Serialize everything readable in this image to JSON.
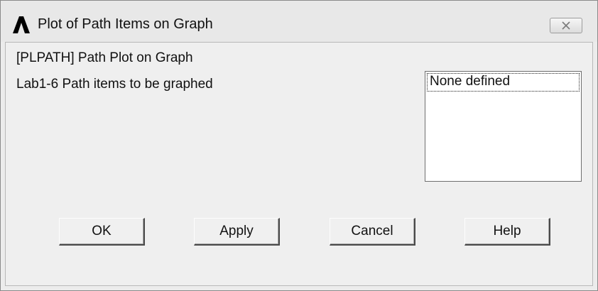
{
  "window": {
    "title": "Plot of Path Items on Graph",
    "icon": "ansys-a-logo-icon",
    "close_icon": "close-icon"
  },
  "content": {
    "command_label": "[PLPATH]  Path Plot on Graph",
    "field_label": "Lab1-6  Path items to be graphed",
    "listbox": {
      "items": [
        "None defined"
      ],
      "selected": "None defined"
    }
  },
  "buttons": {
    "ok": "OK",
    "apply": "Apply",
    "cancel": "Cancel",
    "help": "Help"
  }
}
